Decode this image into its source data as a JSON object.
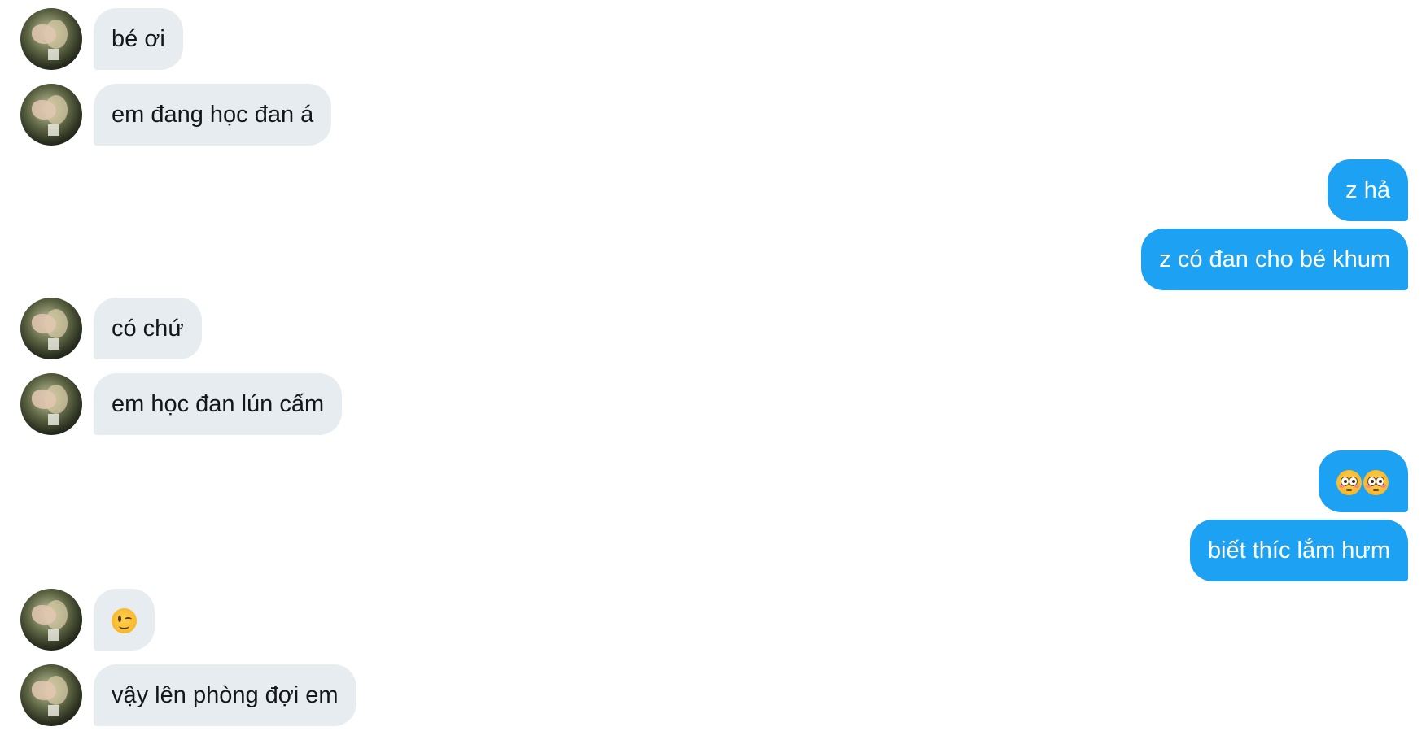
{
  "conversation": {
    "messages": [
      {
        "direction": "in",
        "text": "bé ơi"
      },
      {
        "direction": "in",
        "text": "em đang học đan á"
      },
      {
        "direction": "out",
        "text": "z hả"
      },
      {
        "direction": "out",
        "text": "z có đan cho bé khum"
      },
      {
        "direction": "in",
        "text": "có chứ"
      },
      {
        "direction": "in",
        "text": "em học đan lún cấm"
      },
      {
        "direction": "out",
        "emoji": [
          "flushed-face-emoji",
          "flushed-face-emoji"
        ],
        "text": "😳😳"
      },
      {
        "direction": "out",
        "text": "biết thíc lắm hưm"
      },
      {
        "direction": "in",
        "emoji": [
          "winking-face-emoji"
        ],
        "text": "😉"
      },
      {
        "direction": "in",
        "text": "vậy lên phòng đợi em"
      }
    ]
  },
  "colors": {
    "incoming_bubble": "#e6ecf0",
    "outgoing_bubble": "#1da1f2",
    "incoming_text": "#14171a",
    "outgoing_text": "#ffffff",
    "background": "#ffffff"
  },
  "icons": {
    "sender_avatar": "avatar-photo"
  }
}
